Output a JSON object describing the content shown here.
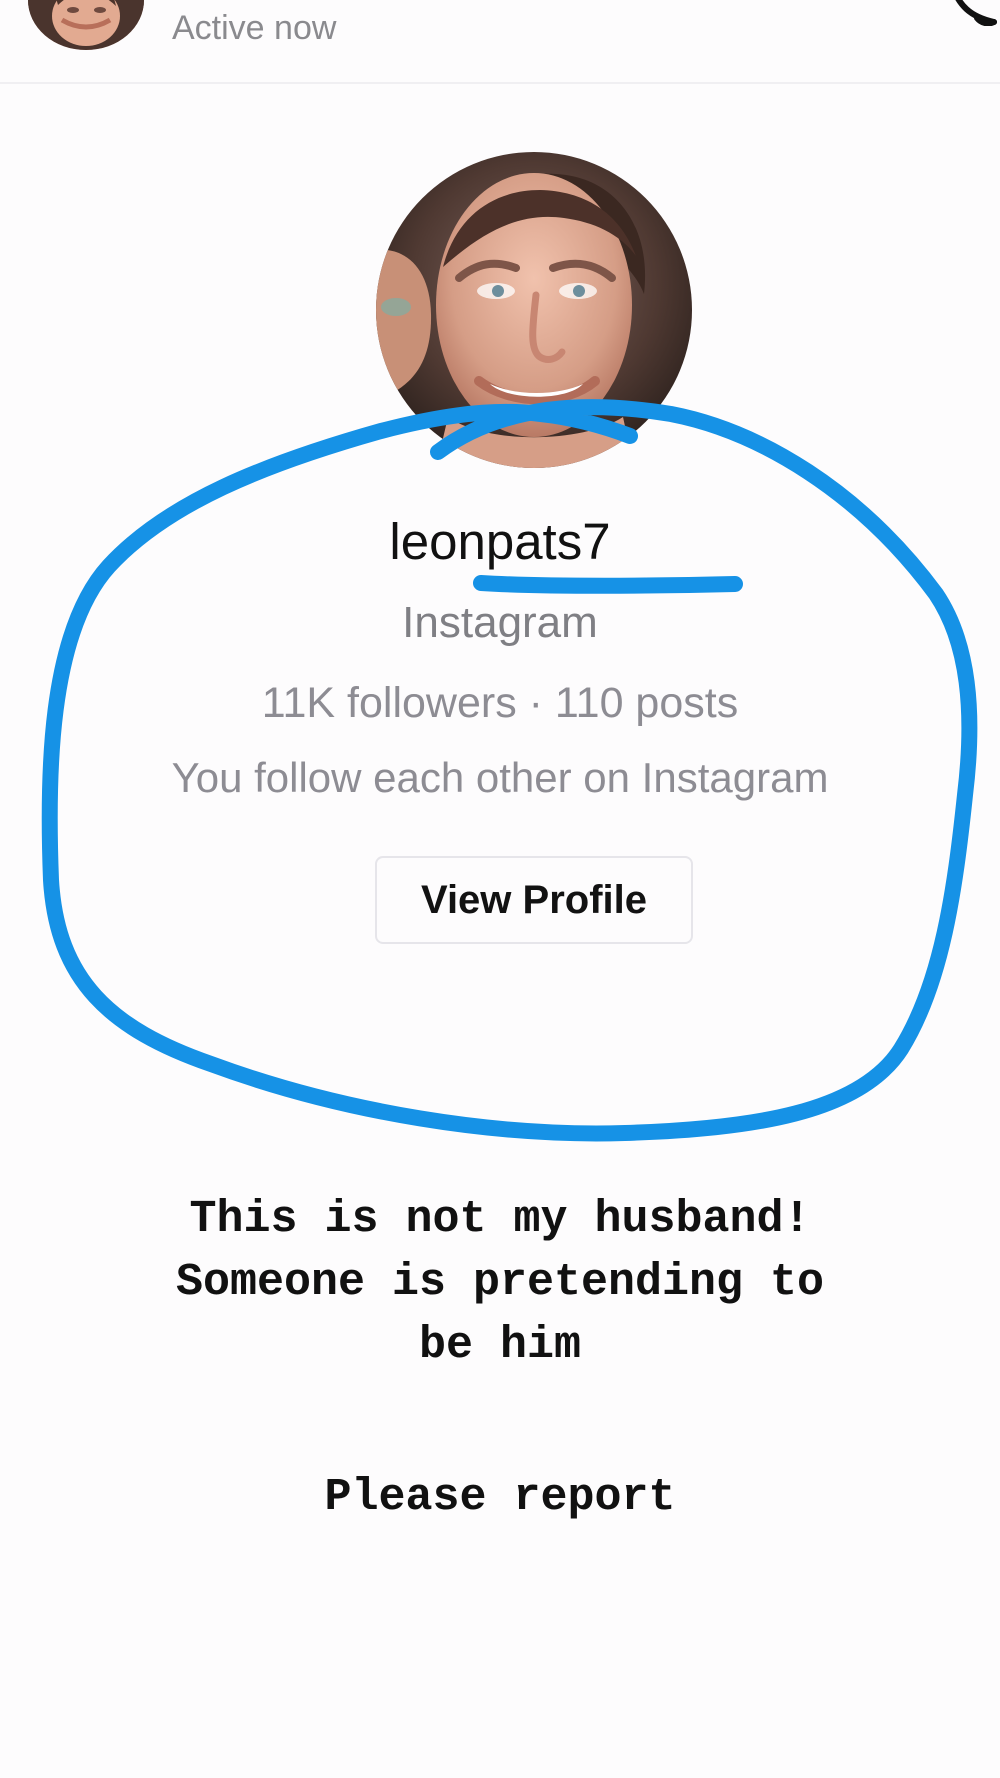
{
  "header": {
    "status": "Active now",
    "call_icon": "phone-icon",
    "avatar_icon": "profile-avatar"
  },
  "profile": {
    "username": "leonpats7",
    "platform": "Instagram",
    "stats": "11K followers · 110 posts",
    "relationship": "You follow each other on Instagram",
    "button_label": "View Profile"
  },
  "annotation": {
    "color": "#1692e6",
    "caption_lines": [
      "This is not my husband!",
      "Someone is pretending to",
      "be him"
    ],
    "report_line": "Please report"
  }
}
